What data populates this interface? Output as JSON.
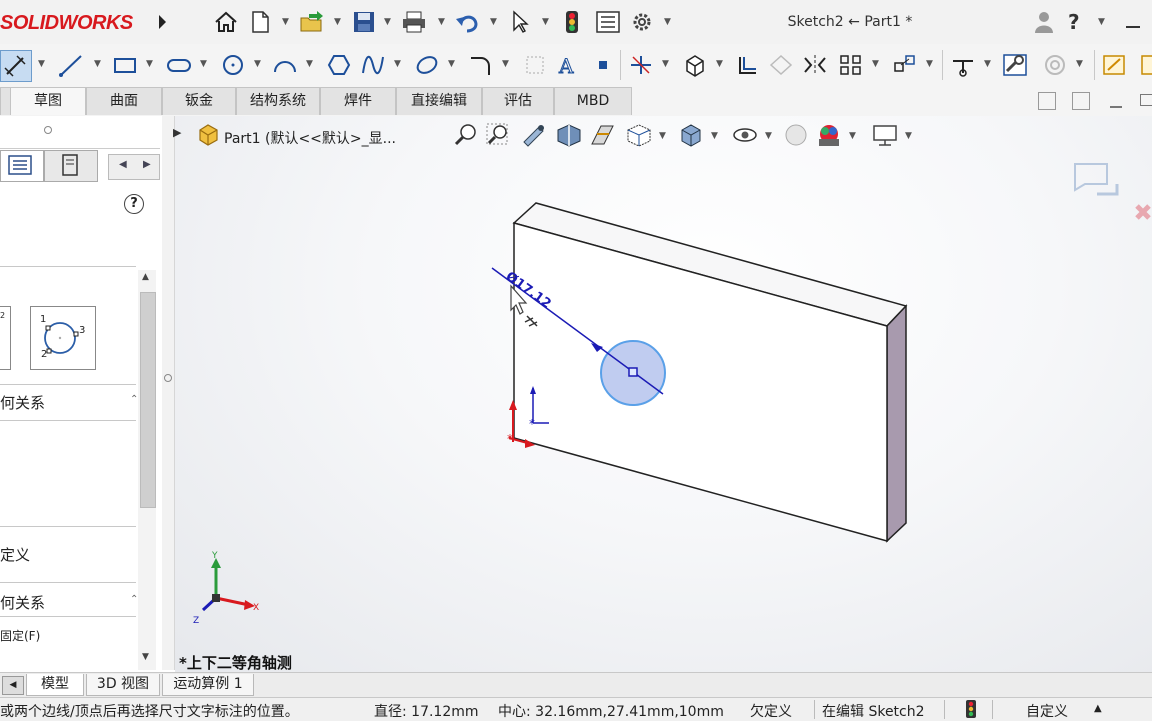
{
  "app": {
    "logo_text": "SOLIDWORKS",
    "document_title": "Sketch2 ← Part1 *",
    "help_label": "?"
  },
  "title_toolbar_icons": [
    "home-icon",
    "new-document-icon",
    "open-icon",
    "save-icon",
    "print-icon",
    "undo-icon",
    "select-pointer-icon",
    "rebuild-traffic-light-icon",
    "file-properties-icon",
    "options-gear-icon"
  ],
  "sketch_toolbar_icons": [
    "smart-dimension-icon",
    "line-icon",
    "rectangle-icon",
    "slot-icon",
    "circle-icon",
    "arc-icon",
    "polygon-icon",
    "spline-icon",
    "ellipse-icon",
    "fillet-icon",
    "point-icon",
    "text-icon",
    "dot-icon",
    "trim-icon",
    "convert-entities-icon",
    "offset-icon",
    "mirror-icon",
    "linear-pattern-icon",
    "move-icon",
    "display-relations-icon",
    "repair-sketch-icon",
    "quick-snaps-icon",
    "instant2d-icon",
    "rapid-sketch-icon"
  ],
  "tabs": [
    "草图",
    "曲面",
    "钣金",
    "结构系统",
    "焊件",
    "直接编辑",
    "评估",
    "MBD"
  ],
  "left_pane": {
    "help_icon": "?",
    "circle_type_labels": [
      "1",
      "2",
      "3"
    ],
    "section1": "何关系",
    "section2": "定义",
    "section3": "何关系",
    "section4": "固定(F)"
  },
  "viewport": {
    "tree_item": "Part1 (默认<<默认>_显...",
    "dimension_text": "Ø17.12",
    "view_label": "*上下二等角轴测",
    "triad": {
      "x": "X",
      "y": "Y",
      "z": "Z"
    }
  },
  "heads_up_icons": [
    "zoom-to-fit-icon",
    "zoom-to-area-icon",
    "previous-view-icon",
    "section-view-icon",
    "dynamic-annotation-icon",
    "view-orientation-icon",
    "display-style-icon",
    "hide-show-items-icon",
    "edit-appearance-icon",
    "apply-scene-icon",
    "view-settings-icon"
  ],
  "bottom_tabs": [
    "模型",
    "3D 视图",
    "运动算例 1"
  ],
  "status": {
    "hint": "或两个边线/顶点后再选择尺寸文字标注的位置。",
    "diameter": "直径: 17.12mm",
    "center": "中心: 32.16mm,27.41mm,10mm",
    "state": "欠定义",
    "editing": "在编辑 Sketch2",
    "units": "自定义"
  },
  "colors": {
    "brand_red": "#d8191e",
    "sketch_blue": "#1b1bb5",
    "circle_fill": "#b9c6ee",
    "part_side": "#a89aae"
  }
}
